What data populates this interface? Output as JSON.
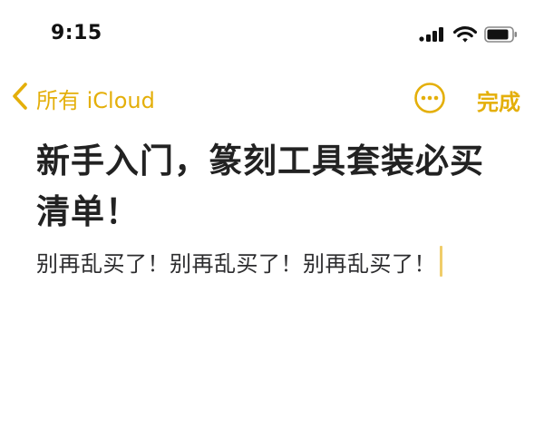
{
  "status_bar": {
    "time": "9:15",
    "icons": [
      "cellular-signal-icon",
      "wifi-icon",
      "battery-icon"
    ]
  },
  "nav": {
    "back_icon": "chevron-left-icon",
    "back_label": "所有 iCloud",
    "more_icon": "ellipsis-circle-icon",
    "done_label": "完成"
  },
  "note": {
    "title": "新手入门，篆刻工具套装必买清单！",
    "body": "别再乱买了！别再乱买了！别再乱买了！"
  },
  "colors": {
    "accent": "#e4af0a",
    "cursor": "#f0cd6a",
    "text": "#222222",
    "background": "#ffffff"
  }
}
